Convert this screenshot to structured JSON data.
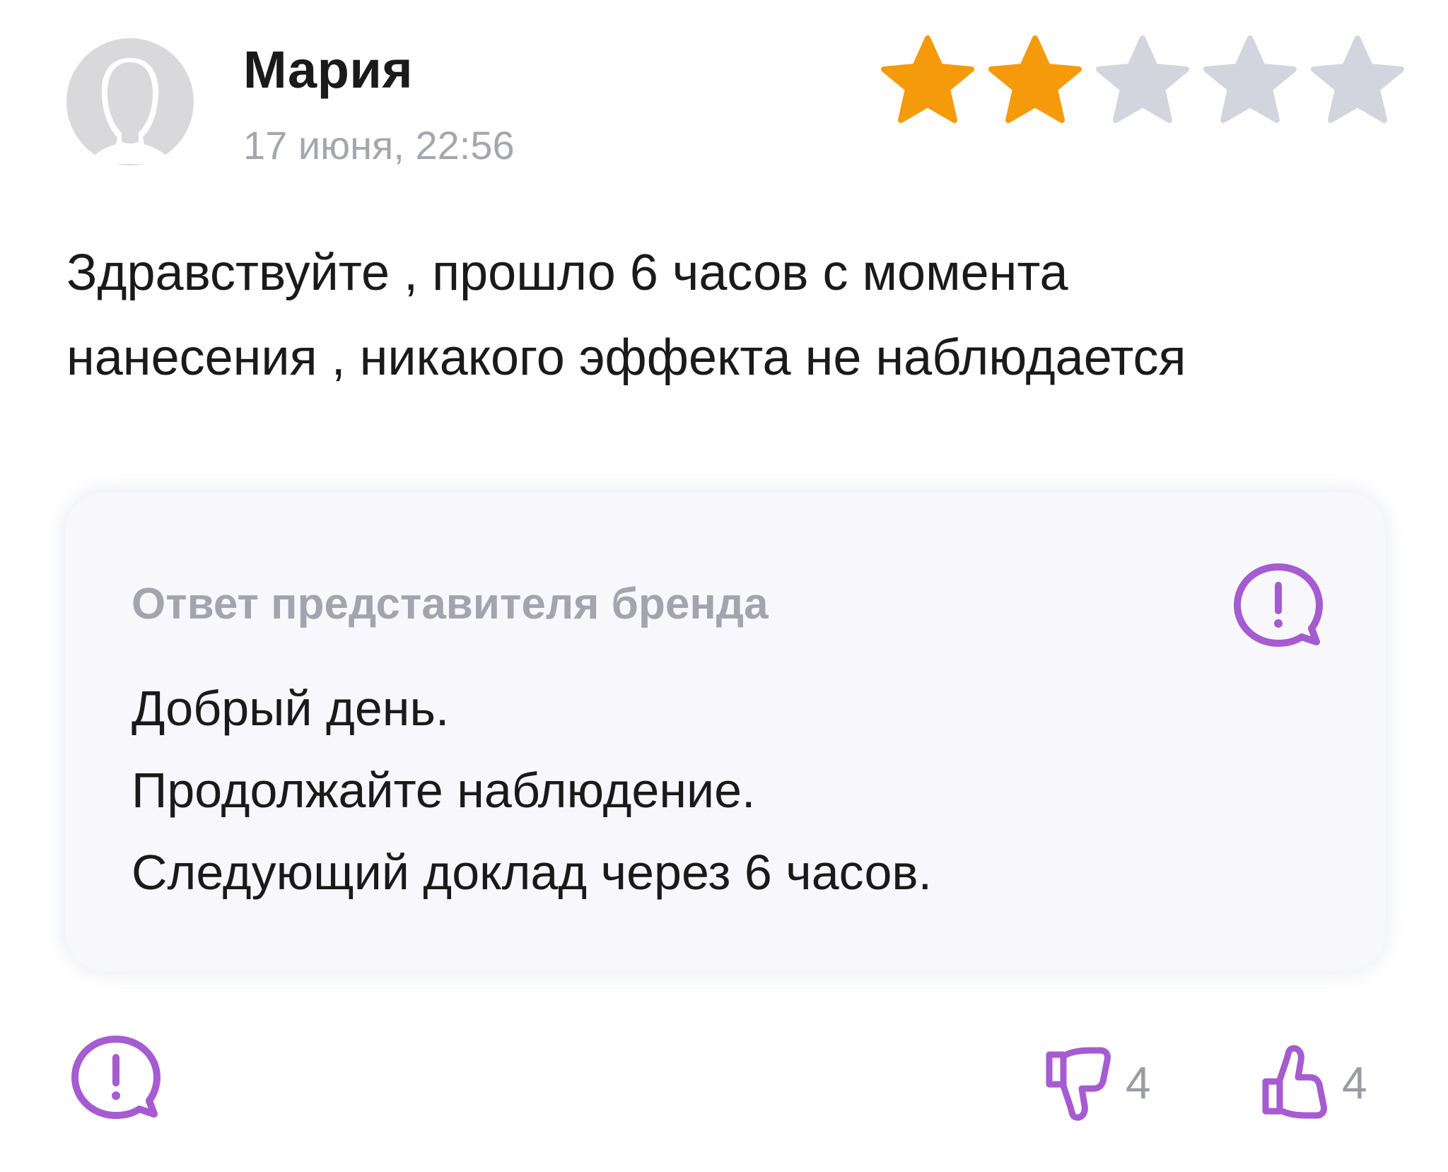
{
  "review": {
    "author": "Мария",
    "date": "17 июня, 22:56",
    "rating": 2,
    "rating_max": 5,
    "text": "Здравствуйте , прошло 6 часов с момента\nнанесения , никакого эффекта не наблюдается"
  },
  "brand_reply": {
    "title": "Ответ представителя бренда",
    "text": "Добрый день.\nПродолжайте наблюдение.\nСледующий доклад через 6 часов."
  },
  "actions": {
    "dislikes": "4",
    "likes": "4"
  },
  "colors": {
    "star_active": "#f59a0b",
    "star_inactive": "#d3d5de",
    "accent": "#a65bd0",
    "muted_text": "#a5a6ae",
    "reply_bg": "#f8f8fc"
  },
  "icons": {
    "avatar": "user-silhouette-icon",
    "report": "speech-bubble-exclamation-icon",
    "dislike": "thumbs-down-icon",
    "like": "thumbs-up-icon",
    "star": "star-icon"
  }
}
